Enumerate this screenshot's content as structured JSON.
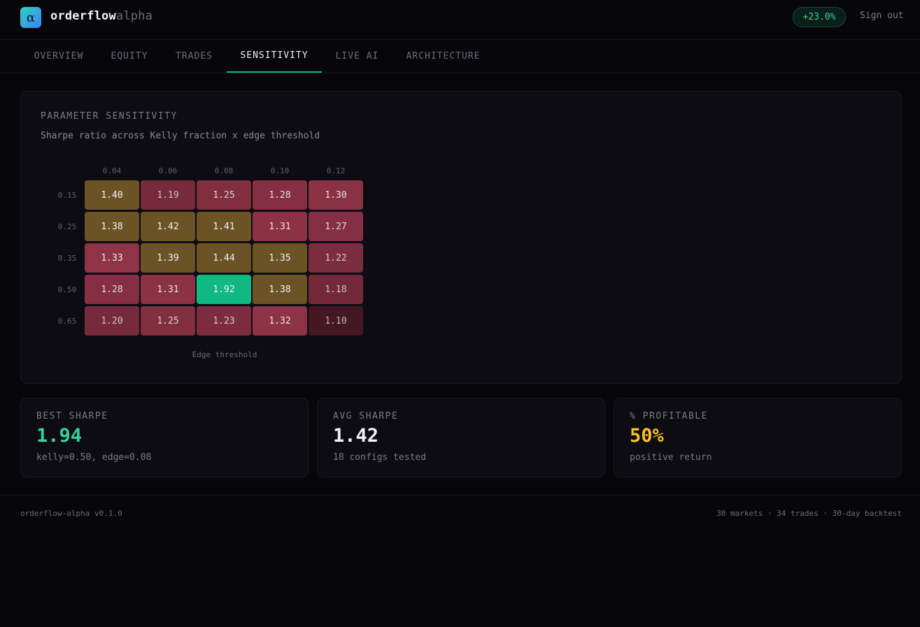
{
  "header": {
    "logo_glyph": "α",
    "brand_primary": "orderflow",
    "brand_secondary": "alpha",
    "pnl_badge": "+23.0%",
    "sign_out": "Sign out"
  },
  "tabs": [
    {
      "label": "OVERVIEW",
      "active": false
    },
    {
      "label": "EQUITY",
      "active": false
    },
    {
      "label": "TRADES",
      "active": false
    },
    {
      "label": "SENSITIVITY",
      "active": true
    },
    {
      "label": "LIVE AI",
      "active": false
    },
    {
      "label": "ARCHITECTURE",
      "active": false
    }
  ],
  "panel": {
    "title": "PARAMETER SENSITIVITY",
    "subtitle": "Sharpe ratio across Kelly fraction x edge threshold"
  },
  "chart_data": {
    "type": "heatmap",
    "xlabel": "Edge threshold",
    "ylabel": "",
    "x": [
      "0.04",
      "0.06",
      "0.08",
      "0.10",
      "0.12"
    ],
    "y": [
      "0.15",
      "0.25",
      "0.35",
      "0.50",
      "0.65"
    ],
    "values": [
      [
        1.4,
        1.19,
        1.25,
        1.28,
        1.3
      ],
      [
        1.38,
        1.42,
        1.41,
        1.31,
        1.27
      ],
      [
        1.33,
        1.39,
        1.44,
        1.35,
        1.22
      ],
      [
        1.28,
        1.31,
        1.92,
        1.38,
        1.18
      ],
      [
        1.2,
        1.25,
        1.23,
        1.32,
        1.1
      ]
    ],
    "labels": [
      [
        "1.40",
        "1.19",
        "1.25",
        "1.28",
        "1.30"
      ],
      [
        "1.38",
        "1.42",
        "1.41",
        "1.31",
        "1.27"
      ],
      [
        "1.33",
        "1.39",
        "1.44",
        "1.35",
        "1.22"
      ],
      [
        "1.28",
        "1.31",
        "1.92",
        "1.38",
        "1.18"
      ],
      [
        "1.20",
        "1.25",
        "1.23",
        "1.32",
        "1.10"
      ]
    ],
    "colors": {
      "best": "#10b981",
      "high": "#6b5326",
      "mid": "#93344a",
      "low": "#5a1f2e"
    }
  },
  "stats": [
    {
      "label": "BEST SHARPE",
      "value": "1.94",
      "note": "kelly=0.50, edge=0.08",
      "color": "#34d399"
    },
    {
      "label": "AVG SHARPE",
      "value": "1.42",
      "note": "18 configs tested",
      "color": "#f2f2f6"
    },
    {
      "label": "% PROFITABLE",
      "value": "50%",
      "note": "positive return",
      "color": "#fbbf24"
    }
  ],
  "footer": {
    "version": "orderflow-alpha v0.1.0",
    "summary": "30 markets · 34 trades · 30-day backtest"
  }
}
